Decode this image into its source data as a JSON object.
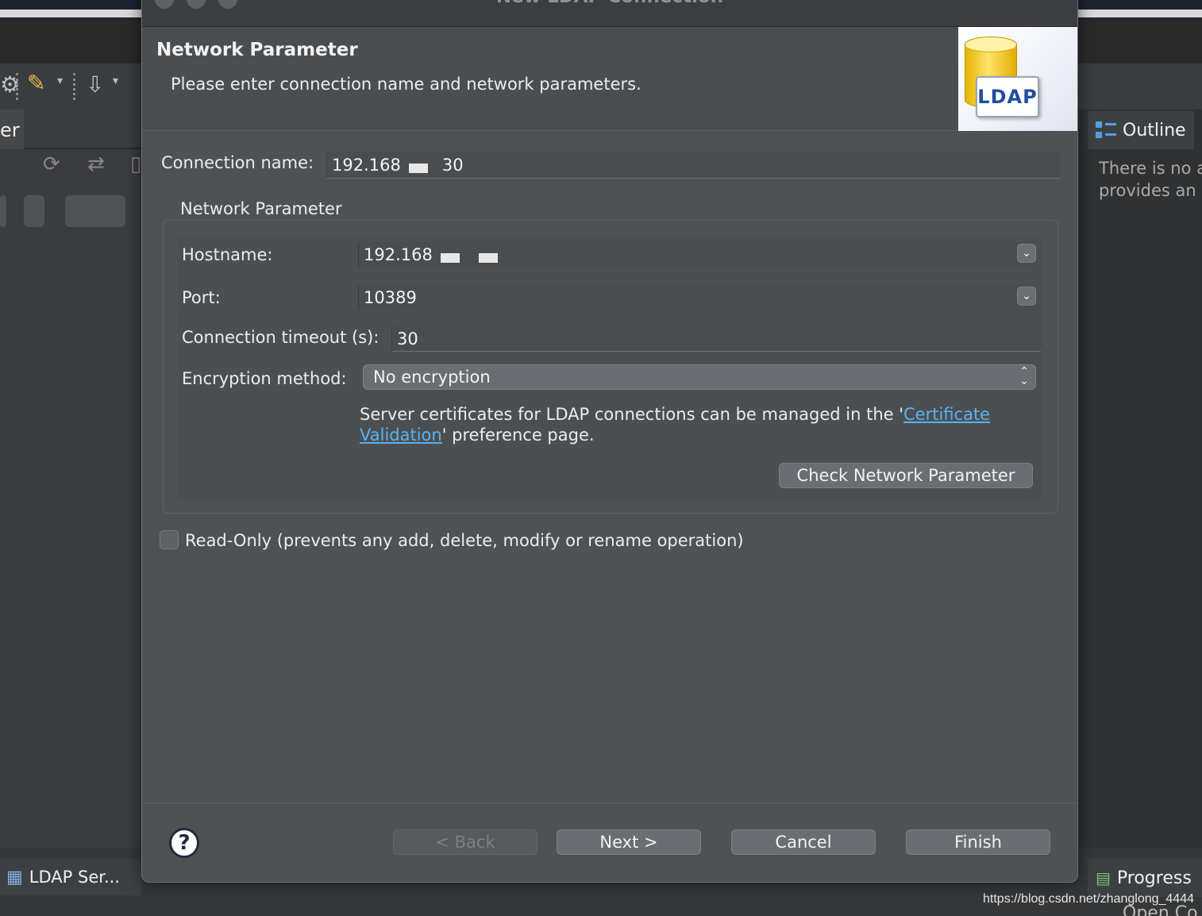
{
  "dialog": {
    "title": "New LDAP Connection",
    "header_title": "Network Parameter",
    "header_description": "Please enter connection name and network parameters.",
    "logo_text": "LDAP"
  },
  "form": {
    "connection_name_label": "Connection name:",
    "connection_name_prefix": "192.168",
    "connection_name_suffix": "30",
    "group_title": "Network Parameter",
    "hostname_label": "Hostname:",
    "hostname_value": "192.168",
    "port_label": "Port:",
    "port_value": "10389",
    "timeout_label": "Connection timeout (s):",
    "timeout_value": "30",
    "encryption_label": "Encryption method:",
    "encryption_value": "No encryption",
    "info_text_1": "Server certificates for LDAP connections can be managed in the '",
    "info_link": "Certificate Validation",
    "info_text_2": "' preference page.",
    "check_button": "Check Network Parameter",
    "readonly_label": "Read-Only (prevents any add, delete, modify or rename operation)",
    "readonly_checked": false
  },
  "footer": {
    "back": "< Back",
    "next": "Next >",
    "cancel": "Cancel",
    "finish": "Finish",
    "help_icon": "?"
  },
  "background": {
    "left_tab": "er",
    "outline_tab": "Outline",
    "outline_text_1": "There is no a",
    "outline_text_2": "provides an",
    "ldap_servers_tab": "LDAP Ser...",
    "progress_tab": "Progress",
    "bottom_cut_text": "Open Co",
    "watermark": "https://blog.csdn.net/zhanglong_4444"
  }
}
